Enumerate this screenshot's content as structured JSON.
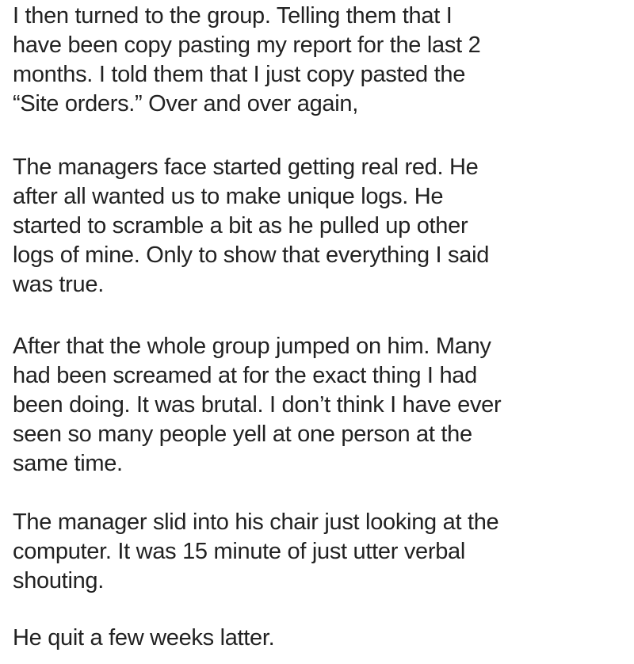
{
  "paragraphs": [
    {
      "lines": [
        "I then turned to the group. Telling them that I",
        "have been copy pasting my report for the last 2",
        "months.  I told them that I just copy pasted the",
        "“Site orders.”  Over and over again,"
      ]
    },
    {
      "lines": [
        "The managers face started getting real red.  He",
        "after all wanted us to make unique logs.  He",
        "started to scramble a bit as he pulled up other",
        "logs of mine.  Only to show that everything I said",
        "was true."
      ]
    },
    {
      "lines": [
        "After that the whole group jumped on him.  Many",
        "had been screamed at for the exact thing I had",
        "been doing.  It was brutal. I don’t think I have ever",
        "seen so many people yell at one person at the",
        "same time."
      ]
    },
    {
      "lines": [
        "The manager slid into his chair just looking at the",
        "computer.  It was 15 minute of just utter verbal",
        "shouting."
      ]
    },
    {
      "lines": [
        "He quit a few weeks latter."
      ]
    }
  ]
}
